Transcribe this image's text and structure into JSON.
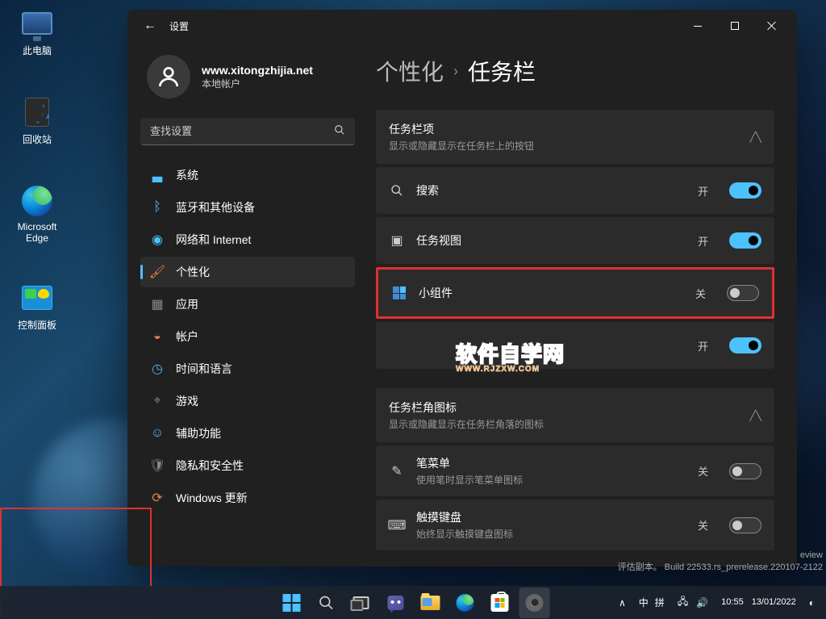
{
  "desktop": {
    "icons": {
      "this_pc": "此电脑",
      "recycle_bin": "回收站",
      "edge": "Microsoft Edge",
      "control_panel": "控制面板"
    }
  },
  "window": {
    "title": "设置",
    "back": "←"
  },
  "profile": {
    "name": "www.xitongzhijia.net",
    "account_type": "本地帐户"
  },
  "search": {
    "placeholder": "查找设置"
  },
  "nav": {
    "system": "系统",
    "bluetooth": "蓝牙和其他设备",
    "network": "网络和 Internet",
    "personalization": "个性化",
    "apps": "应用",
    "accounts": "帐户",
    "time_language": "时间和语言",
    "gaming": "游戏",
    "accessibility": "辅助功能",
    "privacy": "隐私和安全性",
    "windows_update": "Windows 更新"
  },
  "breadcrumb": {
    "parent": "个性化",
    "current": "任务栏"
  },
  "sections": {
    "taskbar_items": {
      "title": "任务栏项",
      "subtitle": "显示或隐藏显示在任务栏上的按钮"
    },
    "corner_icons": {
      "title": "任务栏角图标",
      "subtitle": "显示或隐藏显示在任务栏角落的图标"
    }
  },
  "rows": {
    "search": {
      "label": "搜索",
      "state": "开"
    },
    "taskview": {
      "label": "任务视图",
      "state": "开"
    },
    "widgets": {
      "label": "小组件",
      "state": "关"
    },
    "chat": {
      "label": "",
      "state": "开"
    },
    "pen": {
      "label": "笔菜单",
      "sub": "使用笔时显示笔菜单图标",
      "state": "关"
    },
    "touch_keyboard": {
      "label": "触摸键盘",
      "sub": "始终显示触摸键盘图标",
      "state": "关"
    }
  },
  "watermark": {
    "line1": "软件自学网",
    "line2": "WWW.RJZXW.COM"
  },
  "build_info": {
    "eval": "评估副本。",
    "build": "Build 22533.rs_prerelease.220107-2122",
    "preview_suffix": "eview"
  },
  "taskbar": {
    "ime": {
      "a": "中",
      "b": "拼"
    },
    "chevron": "∧",
    "time": "10:55",
    "date": "13/01/2022"
  }
}
